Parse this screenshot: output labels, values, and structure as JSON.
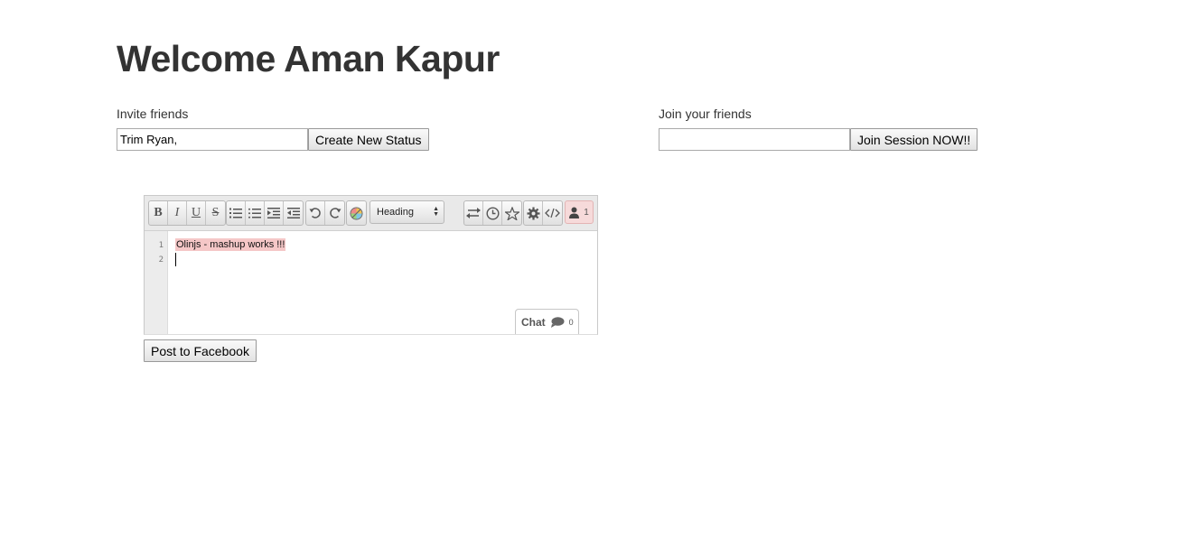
{
  "page": {
    "title": "Welcome Aman Kapur"
  },
  "invite": {
    "label": "Invite friends",
    "input_value": "Trim Ryan,",
    "button_label": "Create New Status"
  },
  "join": {
    "label": "Join your friends",
    "input_value": "",
    "button_label": "Join Session NOW!!"
  },
  "editor": {
    "toolbar": {
      "bold": "B",
      "italic": "I",
      "underline": "U",
      "strikethrough": "S",
      "heading_select": "Heading",
      "user_count": "1"
    },
    "line_numbers": [
      "1",
      "2"
    ],
    "lines": [
      "Olinjs - mashup works !!!",
      ""
    ],
    "chat": {
      "label": "Chat",
      "count": "0"
    }
  },
  "post_button": "Post to Facebook",
  "colors": {
    "user_highlight": "#f5c7c7",
    "user_badge": "#f6dada"
  }
}
